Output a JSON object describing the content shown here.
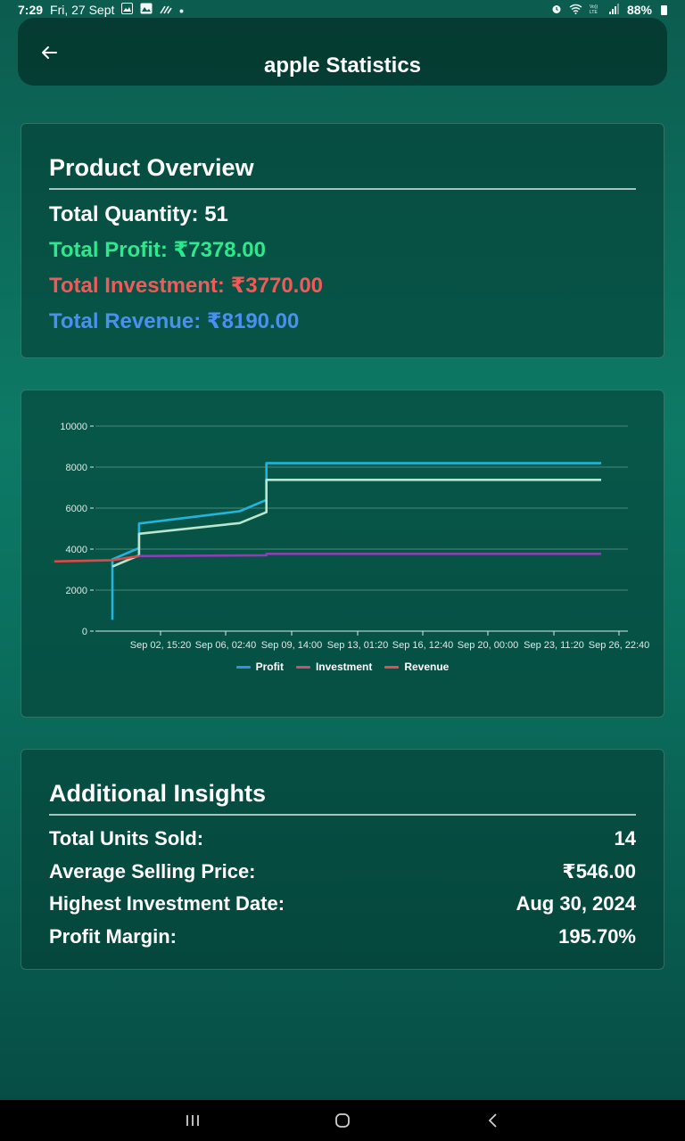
{
  "status_bar": {
    "time": "7:29",
    "date": "Fri, 27 Sept",
    "battery": "88%",
    "icons": [
      "gallery-icon",
      "image-icon",
      "signal-waves-icon",
      "dot-icon",
      "alarm-icon",
      "wifi-icon",
      "volte-icon",
      "cellular-signal-icon",
      "battery-icon"
    ]
  },
  "header": {
    "title": "apple Statistics",
    "back_icon": "back-arrow-icon"
  },
  "overview": {
    "title": "Product Overview",
    "total_quantity": "Total Quantity: 51",
    "total_profit": "Total Profit: ₹7378.00",
    "total_investment": "Total Investment: ₹3770.00",
    "total_revenue": "Total Revenue: ₹8190.00",
    "colors": {
      "profit": "#2ee88d",
      "investment": "#f05a59",
      "revenue": "#4a90f0"
    }
  },
  "chart_data": {
    "type": "line",
    "title": "",
    "xlabel": "",
    "ylabel": "",
    "ylim": [
      0,
      10000
    ],
    "yticks": [
      "0",
      "2000",
      "4000",
      "6000",
      "8000",
      "10000"
    ],
    "xticks": [
      "Sep 02, 15:20",
      "Sep 06, 02:40",
      "Sep 09, 14:00",
      "Sep 13, 01:20",
      "Sep 16, 12:40",
      "Sep 20, 00:00",
      "Sep 23, 11:20",
      "Sep 26, 22:40"
    ],
    "grid": true,
    "legend_placement": "bottom-center",
    "legend": [
      "Profit",
      "Investment",
      "Revenue"
    ],
    "legend_colors": [
      "#3b8fd9",
      "#c0566b",
      "#e05050"
    ],
    "series": [
      {
        "name": "Revenue",
        "color": "#22b4dc",
        "points": [
          [
            "Aug 31, 02:00",
            550
          ],
          [
            "Aug 31, 02:00",
            3500
          ],
          [
            "Sep 01, 12:00",
            4050
          ],
          [
            "Sep 01, 12:00",
            5250
          ],
          [
            "Sep 06, 20:00",
            5850
          ],
          [
            "Sep 08, 06:00",
            6400
          ],
          [
            "Sep 08, 06:00",
            8190
          ],
          [
            "Sep 26, 00:00",
            8190
          ]
        ]
      },
      {
        "name": "Profit",
        "color": "#b8e6cf",
        "points": [
          [
            "Aug 31, 02:00",
            3150
          ],
          [
            "Sep 01, 12:00",
            3700
          ],
          [
            "Sep 01, 12:00",
            4750
          ],
          [
            "Sep 06, 20:00",
            5270
          ],
          [
            "Sep 08, 06:00",
            5800
          ],
          [
            "Sep 08, 06:00",
            7378
          ],
          [
            "Sep 26, 00:00",
            7378
          ]
        ]
      },
      {
        "name": "Investment",
        "color": "#8a3fb3",
        "points": [
          [
            "Sep 01, 12:00",
            3660
          ],
          [
            "Sep 08, 06:00",
            3700
          ],
          [
            "Sep 08, 06:00",
            3770
          ],
          [
            "Sep 26, 00:00",
            3770
          ]
        ]
      },
      {
        "name": "",
        "color": "#e04848",
        "points": [
          [
            "Aug 28, 00:00",
            3400
          ],
          [
            "Aug 31, 02:00",
            3460
          ],
          [
            "Sep 01, 12:00",
            3660
          ]
        ]
      }
    ]
  },
  "insights": {
    "title": "Additional Insights",
    "rows": [
      {
        "label": "Total Units Sold:",
        "value": "14"
      },
      {
        "label": "Average Selling Price:",
        "value": "₹546.00"
      },
      {
        "label": "Highest Investment Date:",
        "value": "Aug 30, 2024"
      },
      {
        "label": "Profit Margin:",
        "value": "195.70%"
      }
    ]
  },
  "nav_bar": {
    "icons": [
      "recent-apps-icon",
      "home-icon",
      "back-nav-icon"
    ]
  }
}
